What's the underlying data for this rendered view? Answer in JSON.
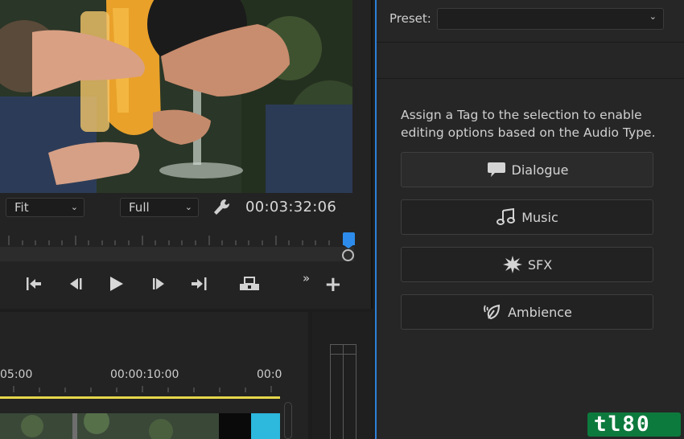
{
  "program_monitor": {
    "fit_select": "Fit",
    "quality_select": "Full",
    "timecode": "00:03:32:06"
  },
  "timeline": {
    "time_labels": [
      "05:00",
      "00:00:10:00",
      "00:0"
    ]
  },
  "essential_sound": {
    "preset_label": "Preset:",
    "preset_value": "",
    "assign_text": "Assign a Tag to the selection to enable editing options based on the Audio Type.",
    "buttons": {
      "dialogue": "Dialogue",
      "music": "Music",
      "sfx": "SFX",
      "ambience": "Ambience"
    }
  },
  "watermark": "tl80",
  "colors": {
    "accent_blue": "#2d8ceb",
    "work_area_yellow": "#e6d84a",
    "clip_cyan": "#2db8dd",
    "watermark_green": "#0d7a3d"
  },
  "icons": [
    "wrench-icon",
    "mark-in-icon",
    "step-back-icon",
    "play-icon",
    "step-forward-icon",
    "mark-out-icon",
    "export-frame-icon",
    "more-icon",
    "add-icon",
    "speech-bubble-icon",
    "music-note-icon",
    "burst-icon",
    "leaf-sound-icon",
    "chevron-down-icon"
  ]
}
